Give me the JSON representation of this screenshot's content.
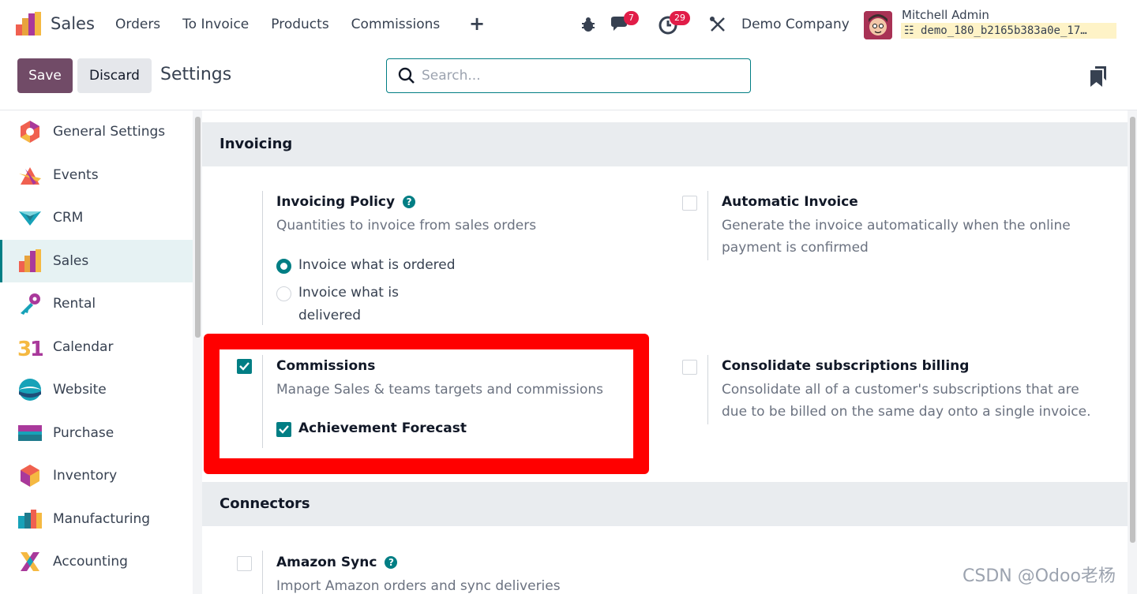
{
  "app": {
    "name": "Sales"
  },
  "menu": [
    "Orders",
    "To Invoice",
    "Products",
    "Commissions"
  ],
  "systray": {
    "messages_count": "7",
    "activities_count": "29",
    "company": "Demo Company",
    "user_name": "Mitchell Admin",
    "db_name": "demo_180_b2165b383a0e_17…"
  },
  "control": {
    "save_label": "Save",
    "discard_label": "Discard",
    "title": "Settings",
    "search_placeholder": "Search..."
  },
  "sidebar": {
    "items": [
      {
        "label": "General Settings"
      },
      {
        "label": "Events"
      },
      {
        "label": "CRM"
      },
      {
        "label": "Sales",
        "active": true
      },
      {
        "label": "Rental"
      },
      {
        "label": "Calendar"
      },
      {
        "label": "Website"
      },
      {
        "label": "Purchase"
      },
      {
        "label": "Inventory"
      },
      {
        "label": "Manufacturing"
      },
      {
        "label": "Accounting"
      }
    ]
  },
  "invoicing": {
    "heading": "Invoicing",
    "policy_title": "Invoicing Policy",
    "policy_desc": "Quantities to invoice from sales orders",
    "option_ordered": "Invoice what is ordered",
    "option_delivered_1": "Invoice what is",
    "option_delivered_2": "delivered",
    "auto_title": "Automatic Invoice",
    "auto_desc": "Generate the invoice automatically when the online payment is confirmed",
    "commissions_title": "Commissions",
    "commissions_desc": "Manage Sales & teams targets and commissions",
    "forecast_label": "Achievement Forecast",
    "consolidate_title": "Consolidate subscriptions billing",
    "consolidate_desc": "Consolidate all of a customer's subscriptions that are due to be billed on the same day onto a single invoice."
  },
  "connectors": {
    "heading": "Connectors",
    "amazon_title": "Amazon Sync",
    "amazon_desc": "Import Amazon orders and sync deliveries"
  },
  "watermark": "CSDN @Odoo老杨",
  "colors": {
    "accent": "#017e84",
    "brand": "#714b67",
    "highlight": "#ff0000"
  }
}
